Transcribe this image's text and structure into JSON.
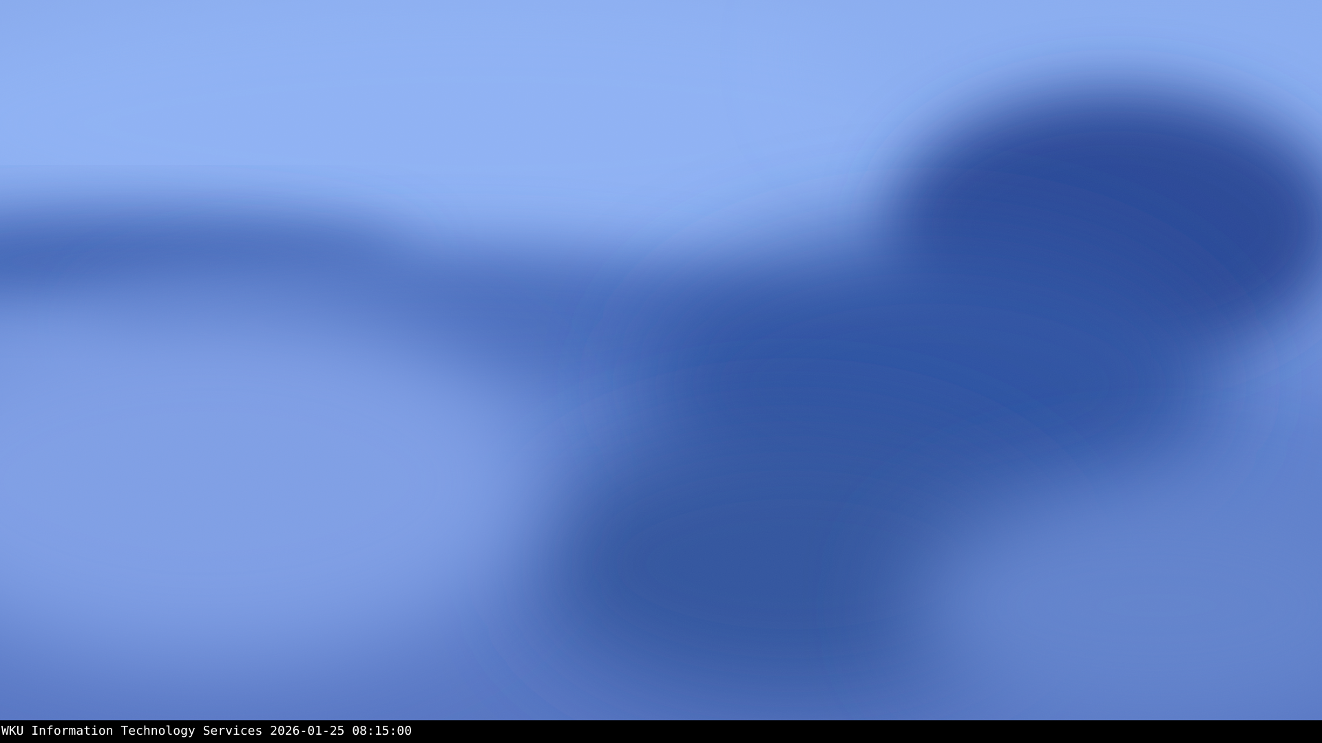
{
  "camera": {
    "overlay_text": "WKU Information Technology Services 2026-01-25 08:15:00",
    "scene": "overcast-sky"
  },
  "colors": {
    "light_cloud": "#8cb0f4",
    "mid_cloud": "#6a8dd8",
    "dark_cloud": "#2a4b96",
    "overlay_bar": "#000000",
    "overlay_text": "#ffffff"
  }
}
